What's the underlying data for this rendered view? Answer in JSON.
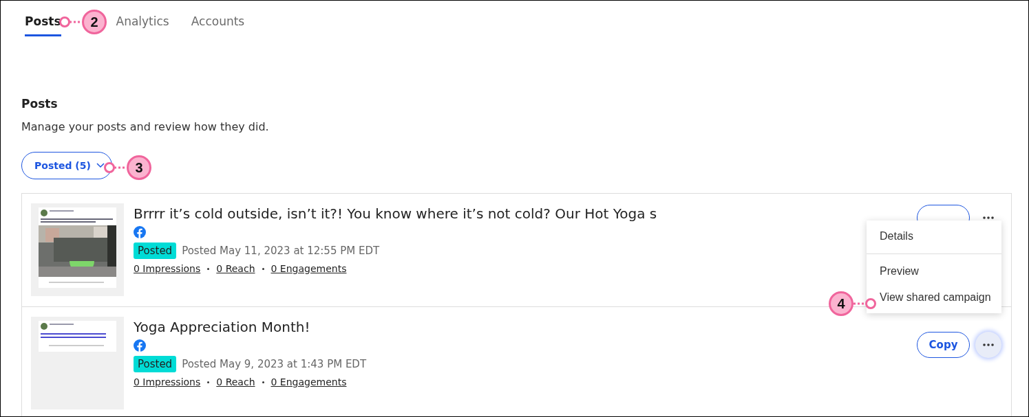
{
  "tabs": [
    {
      "label": "Posts",
      "selected": true
    },
    {
      "label": "Analytics",
      "selected": false
    },
    {
      "label": "Accounts",
      "selected": false
    }
  ],
  "section": {
    "title": "Posts",
    "description": "Manage your posts and review how they did."
  },
  "filter": {
    "label": "Posted (5)"
  },
  "posts": [
    {
      "title": "Brrrr it’s cold outside, isn’t it?! You know where it’s not cold? Our Hot Yoga s",
      "network": {
        "kind": "facebook"
      },
      "status": "Posted",
      "date": "Posted May 11, 2023 at 12:55 PM EDT",
      "metrics": [
        "0 Impressions",
        "0 Reach",
        "0 Engagements"
      ],
      "menu_open": false
    },
    {
      "title": "Yoga Appreciation Month!",
      "network": {
        "kind": "facebook"
      },
      "status": "Posted",
      "date": "Posted May 9, 2023 at 1:43 PM EDT",
      "metrics": [
        "0 Impressions",
        "0 Reach",
        "0 Engagements"
      ],
      "thumbnail": {
        "kind": "link"
      },
      "copy_label": "Copy",
      "menu_open": true
    }
  ],
  "menu": {
    "items": [
      {
        "label": "Details"
      },
      {
        "label": "Preview"
      },
      {
        "label": "View shared campaign"
      }
    ]
  },
  "callouts": [
    {
      "number": "2",
      "kind": "tabs"
    },
    {
      "number": "3",
      "kind": "filter"
    },
    {
      "number": "4",
      "kind": "menu"
    }
  ]
}
